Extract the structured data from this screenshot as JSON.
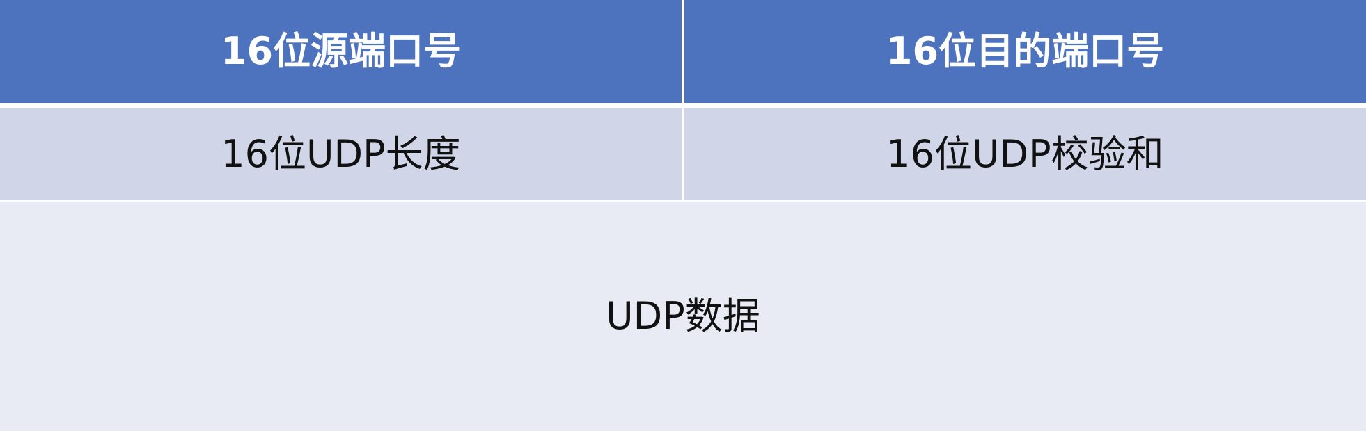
{
  "colors": {
    "header_bg": "#4e73be",
    "row2_bg": "#d0d6e8",
    "data_bg": "#e8ebf4",
    "divider": "#ffffff",
    "header_text": "#ffffff",
    "body_text": "#111111"
  },
  "header": {
    "source_port": "16位源端口号",
    "dest_port": "16位目的端口号"
  },
  "row2": {
    "udp_length": "16位UDP长度",
    "udp_checksum": "16位UDP校验和"
  },
  "data_row": {
    "udp_data": "UDP数据"
  }
}
